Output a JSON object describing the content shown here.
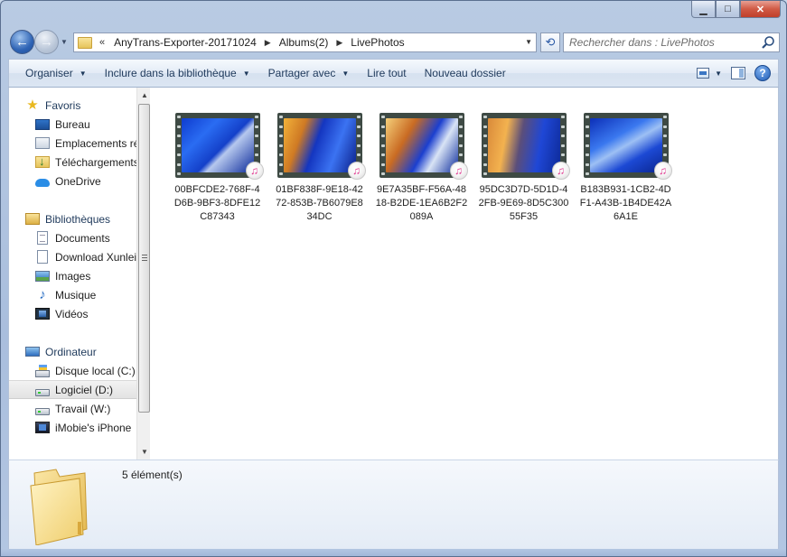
{
  "caption": {
    "minimize": "▁",
    "maximize": "□",
    "close": "✕"
  },
  "address": {
    "lead": "«",
    "crumbs": [
      "AnyTrans-Exporter-20171024",
      "Albums(2)",
      "LivePhotos"
    ]
  },
  "search": {
    "placeholder": "Rechercher dans : LivePhotos"
  },
  "toolbar": {
    "organise": "Organiser",
    "include": "Inclure dans la bibliothèque",
    "share": "Partager avec",
    "play": "Lire tout",
    "new_folder": "Nouveau dossier"
  },
  "nav": {
    "favorites": "Favoris",
    "desktop": "Bureau",
    "places": "Emplacements ré",
    "downloads": "Téléchargements",
    "onedrive": "OneDrive",
    "libraries": "Bibliothèques",
    "documents": "Documents",
    "xunlei": "Download Xunlei",
    "images": "Images",
    "music": "Musique",
    "videos": "Vidéos",
    "computer": "Ordinateur",
    "disk_c": "Disque local (C:)",
    "disk_d": "Logiciel (D:)",
    "disk_w": "Travail (W:)",
    "iphone": "iMobie's iPhone"
  },
  "files": [
    {
      "name": "00BFCDE2-768F-4D6B-9BF3-8DFE12C87343"
    },
    {
      "name": "01BF838F-9E18-4272-853B-7B6079E834DC"
    },
    {
      "name": "9E7A35BF-F56A-4818-B2DE-1EA6B2F2089A"
    },
    {
      "name": "95DC3D7D-5D1D-42FB-9E69-8D5C30055F35"
    },
    {
      "name": "B183B931-1CB2-4DF1-A43B-1B4DE42A6A1E"
    }
  ],
  "details": {
    "count": "5 élément(s)"
  },
  "icons": {
    "back": "back-arrow-icon",
    "forward": "forward-arrow-icon",
    "refresh": "refresh-icon",
    "search": "search-icon",
    "help": "help-icon",
    "itunes": "itunes-music-icon"
  }
}
